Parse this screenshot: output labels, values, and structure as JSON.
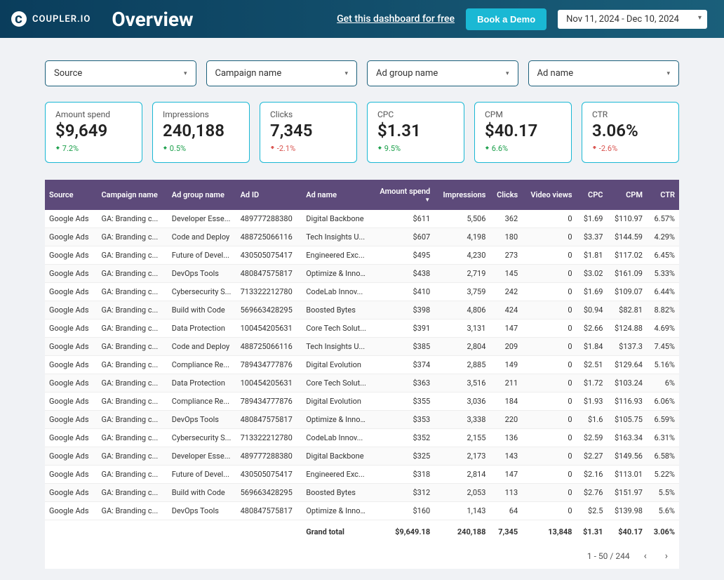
{
  "header": {
    "brand": "COUPLER.IO",
    "title": "Overview",
    "free_link": "Get this dashboard for free",
    "demo_btn": "Book a Demo",
    "date_range": "Nov 11, 2024 - Dec 10, 2024"
  },
  "filters": [
    {
      "label": "Source"
    },
    {
      "label": "Campaign name"
    },
    {
      "label": "Ad group name"
    },
    {
      "label": "Ad name"
    }
  ],
  "kpis": [
    {
      "label": "Amount spend",
      "value": "$9,649",
      "delta": "7.2%",
      "dir": "up"
    },
    {
      "label": "Impressions",
      "value": "240,188",
      "delta": "0.5%",
      "dir": "up"
    },
    {
      "label": "Clicks",
      "value": "7,345",
      "delta": "-2.1%",
      "dir": "down"
    },
    {
      "label": "CPC",
      "value": "$1.31",
      "delta": "9.5%",
      "dir": "up"
    },
    {
      "label": "CPM",
      "value": "$40.17",
      "delta": "6.6%",
      "dir": "up"
    },
    {
      "label": "CTR",
      "value": "3.06%",
      "delta": "-2.6%",
      "dir": "down"
    }
  ],
  "table": {
    "headers": [
      "Source",
      "Campaign name",
      "Ad group name",
      "Ad ID",
      "Ad name",
      "Amount spend",
      "Impressions",
      "Clicks",
      "Video views",
      "CPC",
      "CPM",
      "CTR"
    ],
    "sort_col": "Amount spend",
    "rows": [
      [
        "Google Ads",
        "GA: Branding c...",
        "Developer Esse...",
        "489777288380",
        "Digital Backbone",
        "$611",
        "5,506",
        "362",
        "0",
        "$1.69",
        "$110.97",
        "6.57%"
      ],
      [
        "Google Ads",
        "GA: Branding c...",
        "Code and Deploy",
        "488725066116",
        "Tech Insights U...",
        "$607",
        "4,198",
        "180",
        "0",
        "$3.37",
        "$144.59",
        "4.29%"
      ],
      [
        "Google Ads",
        "GA: Branding c...",
        "Future of Devel...",
        "430505075417",
        "Engineered Exc...",
        "$495",
        "4,230",
        "273",
        "0",
        "$1.81",
        "$117.02",
        "6.45%"
      ],
      [
        "Google Ads",
        "GA: Branding c...",
        "DevOps Tools",
        "480847575817",
        "Optimize & Inno...",
        "$438",
        "2,719",
        "145",
        "0",
        "$3.02",
        "$161.09",
        "5.33%"
      ],
      [
        "Google Ads",
        "GA: Branding c...",
        "Cybersecurity S...",
        "713322212780",
        "CodeLab Innov...",
        "$410",
        "3,759",
        "242",
        "0",
        "$1.69",
        "$109.07",
        "6.44%"
      ],
      [
        "Google Ads",
        "GA: Branding c...",
        "Build with Code",
        "569663428295",
        "Boosted Bytes",
        "$398",
        "4,806",
        "424",
        "0",
        "$0.94",
        "$82.81",
        "8.82%"
      ],
      [
        "Google Ads",
        "GA: Branding c...",
        "Data Protection",
        "100454205631",
        "Core Tech Solut...",
        "$391",
        "3,131",
        "147",
        "0",
        "$2.66",
        "$124.88",
        "4.69%"
      ],
      [
        "Google Ads",
        "GA: Branding c...",
        "Code and Deploy",
        "488725066116",
        "Tech Insights U...",
        "$385",
        "2,804",
        "209",
        "0",
        "$1.84",
        "$137.3",
        "7.45%"
      ],
      [
        "Google Ads",
        "GA: Branding c...",
        "Compliance Re...",
        "789434777876",
        "Digital Evolution",
        "$374",
        "2,885",
        "149",
        "0",
        "$2.51",
        "$129.64",
        "5.16%"
      ],
      [
        "Google Ads",
        "GA: Branding c...",
        "Data Protection",
        "100454205631",
        "Core Tech Solut...",
        "$363",
        "3,516",
        "211",
        "0",
        "$1.72",
        "$103.24",
        "6%"
      ],
      [
        "Google Ads",
        "GA: Branding c...",
        "Compliance Re...",
        "789434777876",
        "Digital Evolution",
        "$355",
        "3,036",
        "184",
        "0",
        "$1.93",
        "$116.93",
        "6.06%"
      ],
      [
        "Google Ads",
        "GA: Branding c...",
        "DevOps Tools",
        "480847575817",
        "Optimize & Inno...",
        "$353",
        "3,338",
        "220",
        "0",
        "$1.6",
        "$105.75",
        "6.59%"
      ],
      [
        "Google Ads",
        "GA: Branding c...",
        "Cybersecurity S...",
        "713322212780",
        "CodeLab Innov...",
        "$352",
        "2,155",
        "136",
        "0",
        "$2.59",
        "$163.34",
        "6.31%"
      ],
      [
        "Google Ads",
        "GA: Branding c...",
        "Developer Esse...",
        "489777288380",
        "Digital Backbone",
        "$325",
        "2,173",
        "143",
        "0",
        "$2.27",
        "$149.56",
        "6.58%"
      ],
      [
        "Google Ads",
        "GA: Branding c...",
        "Future of Devel...",
        "430505075417",
        "Engineered Exc...",
        "$318",
        "2,814",
        "147",
        "0",
        "$2.16",
        "$113.01",
        "5.22%"
      ],
      [
        "Google Ads",
        "GA: Branding c...",
        "Build with Code",
        "569663428295",
        "Boosted Bytes",
        "$312",
        "2,053",
        "113",
        "0",
        "$2.76",
        "$151.97",
        "5.5%"
      ],
      [
        "Google Ads",
        "GA: Branding c...",
        "DevOps Tools",
        "480847575817",
        "Optimize & Inno...",
        "$160",
        "1,143",
        "64",
        "0",
        "$2.5",
        "$139.98",
        "5.6%"
      ]
    ],
    "grand_total": [
      "",
      "",
      "",
      "",
      "Grand total",
      "$9,649.18",
      "240,188",
      "7,345",
      "13,848",
      "$1.31",
      "$40.17",
      "3.06%"
    ],
    "pager": "1 - 50 / 244"
  }
}
